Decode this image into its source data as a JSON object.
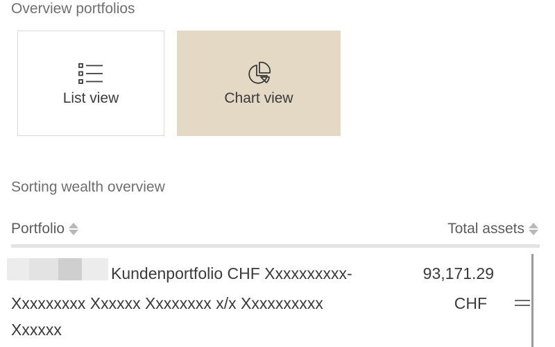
{
  "overview": {
    "label": "Overview portfolios"
  },
  "views": [
    {
      "label": "List view",
      "icon": "list-icon",
      "selected": false
    },
    {
      "label": "Chart view",
      "icon": "pie-chart-icon",
      "selected": true
    }
  ],
  "sorting": {
    "label": "Sorting wealth overview"
  },
  "table": {
    "columns": [
      "Portfolio",
      "Total assets"
    ],
    "rows": [
      {
        "name_line1": "Kundenportfolio CHF Xxxxxxxxxx-",
        "name_line2": "Xxxxxxxxx Xxxxxx Xxxxxxxx x/x Xxxxxxxxxx",
        "name_line3": "Xxxxxx",
        "amount": "93,171.29",
        "currency": "CHF"
      }
    ]
  },
  "colors": {
    "selected_bg": "#e3d9c4",
    "border": "#d9d9d9",
    "text": "#3a3a3a",
    "muted": "#6f6f6f"
  }
}
